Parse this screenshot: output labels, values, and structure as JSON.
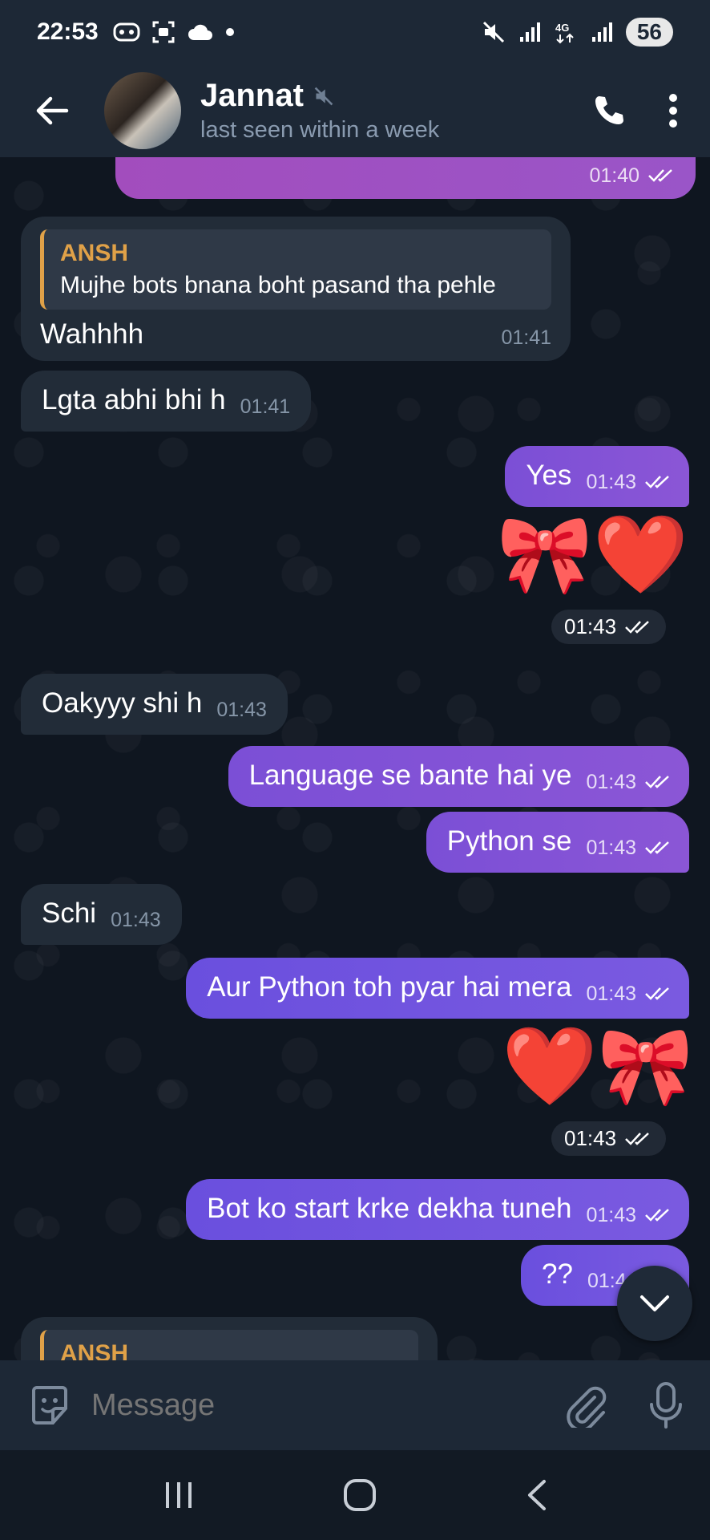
{
  "status_bar": {
    "time": "22:53",
    "battery": "56",
    "left_icons": [
      "gamepad-icon",
      "screen-record-icon",
      "cloud-icon",
      "dot-icon"
    ],
    "right_icons": [
      "mute-icon",
      "signal-icon",
      "4g-icon",
      "signal-icon"
    ]
  },
  "header": {
    "name": "Jannat",
    "status": "last seen within a week",
    "muted": true
  },
  "messages": [
    {
      "direction": "out",
      "text": "",
      "time": "01:40",
      "read": true,
      "partial": true
    },
    {
      "direction": "in",
      "reply_to": {
        "name": "ANSH",
        "text": "Mujhe bots bnana boht pasand tha pehle"
      },
      "text": "Wahhhh",
      "time": "01:41"
    },
    {
      "direction": "in",
      "text": "Lgta abhi bhi h",
      "time": "01:41"
    },
    {
      "direction": "out",
      "text": "Yes",
      "time": "01:43",
      "read": true
    },
    {
      "direction": "out",
      "sticker": "🎀❤️",
      "time": "01:43",
      "read": true
    },
    {
      "direction": "in",
      "text": "Oakyyy shi h",
      "time": "01:43"
    },
    {
      "direction": "out",
      "text": "Language se bante hai ye",
      "time": "01:43",
      "read": true
    },
    {
      "direction": "out",
      "text": "Python se",
      "time": "01:43",
      "read": true
    },
    {
      "direction": "in",
      "text": "Schi",
      "time": "01:43"
    },
    {
      "direction": "out",
      "text": "Aur Python toh pyar hai mera",
      "time": "01:43",
      "read": true
    },
    {
      "direction": "out",
      "sticker": "❤️🎀",
      "time": "01:43",
      "read": true
    },
    {
      "direction": "out",
      "text": "Bot ko start krke dekha tuneh",
      "time": "01:43",
      "read": true
    },
    {
      "direction": "out",
      "text": "??",
      "time": "01:4",
      "read": true,
      "partial": true
    },
    {
      "direction": "in",
      "reply_to": {
        "name": "ANSH",
        "text": ""
      },
      "partial": true
    }
  ],
  "composer": {
    "placeholder": "Message"
  },
  "colors": {
    "accent_reply": "#e0a148",
    "outgoing": "#7b4fd6",
    "incoming": "#222c38",
    "background": "#0f1620"
  }
}
